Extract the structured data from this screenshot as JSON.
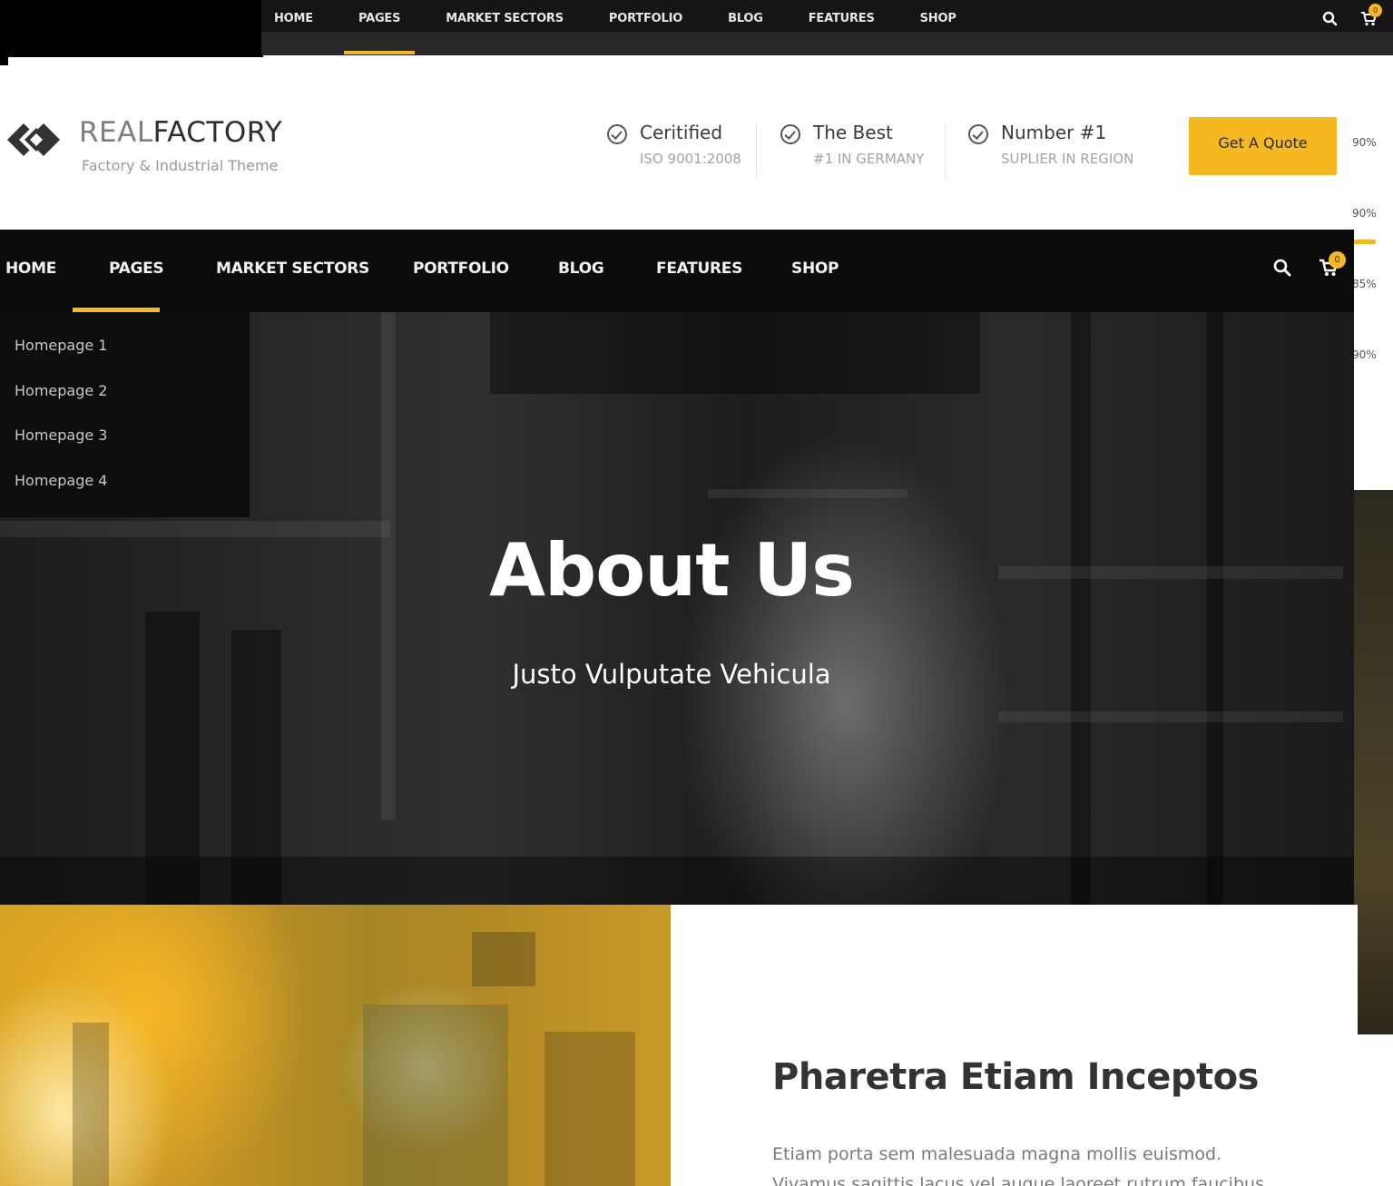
{
  "top_bar": {
    "nav": [
      "HOME",
      "PAGES",
      "MARKET SECTORS",
      "PORTFOLIO",
      "BLOG",
      "FEATURES",
      "SHOP"
    ],
    "active": "PAGES",
    "cart_count": "0",
    "icons": [
      "search-icon",
      "cart-icon"
    ]
  },
  "right_edge": {
    "percentages": [
      "90%",
      "90%",
      "85%",
      "90%"
    ]
  },
  "header": {
    "logo_light": "REAL",
    "logo_dark": "FACTORY",
    "tagline": "Factory & Industrial Theme",
    "info": [
      {
        "title": "Ceritified",
        "subtitle": "ISO 9001:2008"
      },
      {
        "title": "The Best",
        "subtitle": "#1 IN GERMANY"
      },
      {
        "title": "Number #1",
        "subtitle": "SUPLIER IN REGION"
      }
    ],
    "quote_button": "Get A Quote"
  },
  "main_nav": {
    "items": [
      "HOME",
      "PAGES",
      "MARKET SECTORS",
      "PORTFOLIO",
      "BLOG",
      "FEATURES",
      "SHOP"
    ],
    "active": "PAGES",
    "cart_count": "0",
    "accent_color": "#f5b821"
  },
  "dropdown": {
    "items": [
      "Homepage 1",
      "Homepage 2",
      "Homepage 3",
      "Homepage 4"
    ]
  },
  "hero": {
    "title": "About Us",
    "subtitle": "Justo Vulputate Vehicula"
  },
  "content": {
    "title": "Pharetra Etiam Inceptos",
    "text": "Etiam porta sem malesuada magna mollis euismod. Vivamus sagittis lacus vel augue laoreet rutrum faucibus dolor auctor."
  }
}
